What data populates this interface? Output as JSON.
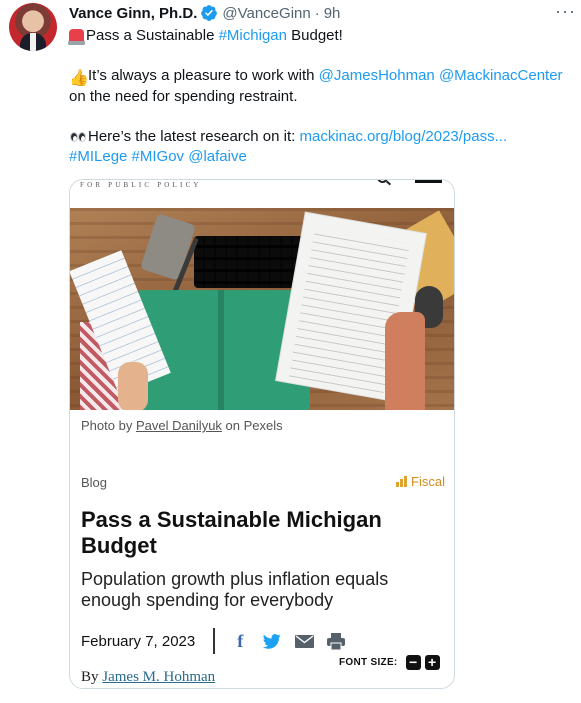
{
  "tweet": {
    "display_name": "Vance Ginn, Ph.D.",
    "handle": "@VanceGinn",
    "dot": "·",
    "time": "9h",
    "more_label": "···",
    "line1_pre": "Pass a Sustainable ",
    "line1_hashtag": "#Michigan",
    "line1_post": " Budget!",
    "line2_pre": "It’s always a pleasure to work with ",
    "line2_mention1": "@JamesHohman",
    "line2_mention2": "@MackinacCenter",
    "line3": "on the need for spending restraint.",
    "line4_pre": "Here’s the latest research on it: ",
    "line4_link": "mackinac.org/blog/2023/pass...",
    "line5_tags": "#MILege #MIGov @lafaive",
    "emojis": [
      "siren-icon",
      "thumbs-up-icon",
      "eyes-icon"
    ]
  },
  "card": {
    "masthead": "FOR PUBLIC POLICY",
    "photo_caption_pre": "Photo by ",
    "photo_caption_link": "Pavel Danilyuk",
    "photo_caption_post": " on Pexels",
    "category": "Blog",
    "topic": "Fiscal",
    "title": "Pass a Sustainable Michigan Budget",
    "subtitle": "Population growth plus inflation equals enough spending for everybody",
    "date": "February 7, 2023",
    "font_size_label": "FONT SIZE:",
    "font_size_minus": "−",
    "font_size_plus": "+",
    "byline_pre": "By ",
    "author": "James M. Hohman",
    "share_icons": [
      "facebook-icon",
      "twitter-icon",
      "email-icon",
      "print-icon"
    ]
  },
  "colors": {
    "link": "#1d9bf0",
    "verified": "#1d9bf0",
    "fiscal": "#d48c1e"
  }
}
